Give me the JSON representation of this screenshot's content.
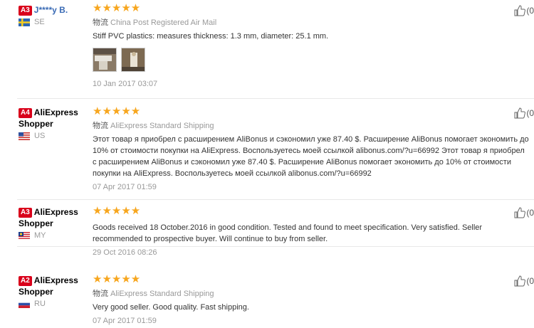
{
  "reviews": [
    {
      "level": "A3",
      "level_color": "#d9001b",
      "name": "J****y B.",
      "country": "SE",
      "stars": "★★★★★",
      "shipping_label": "物流",
      "shipping": "China Post Registered Air Mail",
      "text": "Stiff PVC plastics: measures thickness: 1.3 mm, diameter: 25.1 mm.",
      "date": "10 Jan 2017 03:07",
      "helpful_count": "(0"
    },
    {
      "level": "A4",
      "level_color": "#d9001b",
      "name": "AliExpress Shopper",
      "country": "US",
      "stars": "★★★★★",
      "shipping_label": "物流",
      "shipping": "AliExpress Standard Shipping",
      "text": "Этот товар я приобрел с расширением AliBonus и сэкономил уже 87.40 $. Расширение AliBonus помогает экономить до 10% от стоимости покупки на AliExpress. Воспользуетесь моей ссылкой alibonus.com/?u=66992 Этот товар я приобрел с расширением AliBonus и сэкономил уже 87.40 $. Расширение AliBonus помогает экономить до 10% от стоимости покупки на AliExpress. Воспользуетесь моей ссылкой alibonus.com/?u=66992",
      "date": "07 Apr 2017 01:59",
      "helpful_count": "(0"
    },
    {
      "level": "A3",
      "level_color": "#d9001b",
      "name": "AliExpress Shopper",
      "country": "MY",
      "stars": "★★★★★",
      "text": "Goods received 18 October.2016 in good condition. Tested and found to meet specification. Very satisfied. Seller recommended to prospective buyer. Will continue to buy from seller.",
      "date": "29 Oct 2016 08:26",
      "helpful_count": "(0"
    },
    {
      "level": "A2",
      "level_color": "#d9001b",
      "name": "AliExpress Shopper",
      "country": "RU",
      "stars": "★★★★★",
      "shipping_label": "物流",
      "shipping": "AliExpress Standard Shipping",
      "text": "Very good seller. Good quality. Fast shipping.",
      "date": "07 Apr 2017 01:59",
      "helpful_count": "(0"
    }
  ]
}
